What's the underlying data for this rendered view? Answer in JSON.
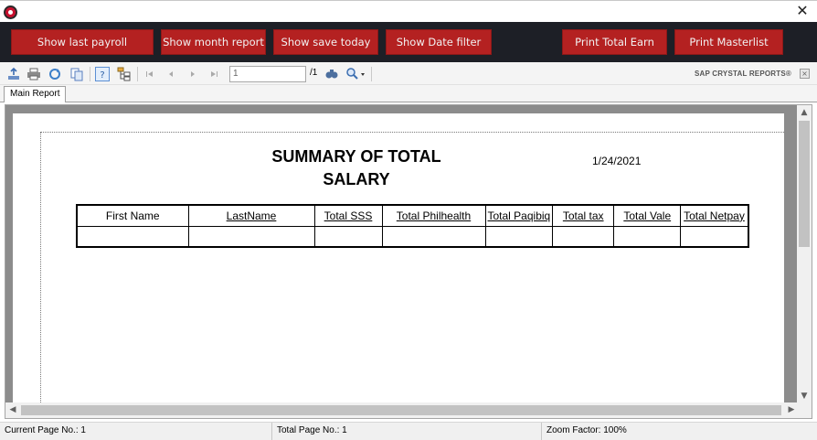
{
  "window": {
    "close_glyph": "✕"
  },
  "commands": [
    {
      "label": "Show last payroll"
    },
    {
      "label": "Show month report"
    },
    {
      "label": "Show save today"
    },
    {
      "label": "Show Date filter"
    },
    {
      "label": "Print Total Earn"
    },
    {
      "label": "Print Masterlist"
    }
  ],
  "viewer": {
    "page_input_value": "1",
    "page_total": "/1",
    "brand": "SAP CRYSTAL REPORTS®",
    "tab_label": "Main Report",
    "icons": [
      "export-icon",
      "print-icon",
      "refresh-icon",
      "copy-icon",
      "help-icon",
      "group-tree-icon",
      "first-page-icon",
      "prev-page-icon",
      "next-page-icon",
      "last-page-icon",
      "find-icon",
      "zoom-icon"
    ]
  },
  "report": {
    "title_line1": "SUMMARY OF TOTAL",
    "title_line2": "SALARY",
    "date": "1/24/2021",
    "columns": [
      "First Name",
      "LastName",
      "Total SSS",
      "Total Philhealth",
      "Total Paqibiq",
      "Total tax",
      "Total Vale",
      "Total Netpay"
    ]
  },
  "status": {
    "current_page": "Current Page No.: 1",
    "total_page": "Total Page No.: 1",
    "zoom": "Zoom Factor: 100%"
  },
  "colors": {
    "command_button": "#b42121",
    "command_bar": "#1d1f26"
  }
}
